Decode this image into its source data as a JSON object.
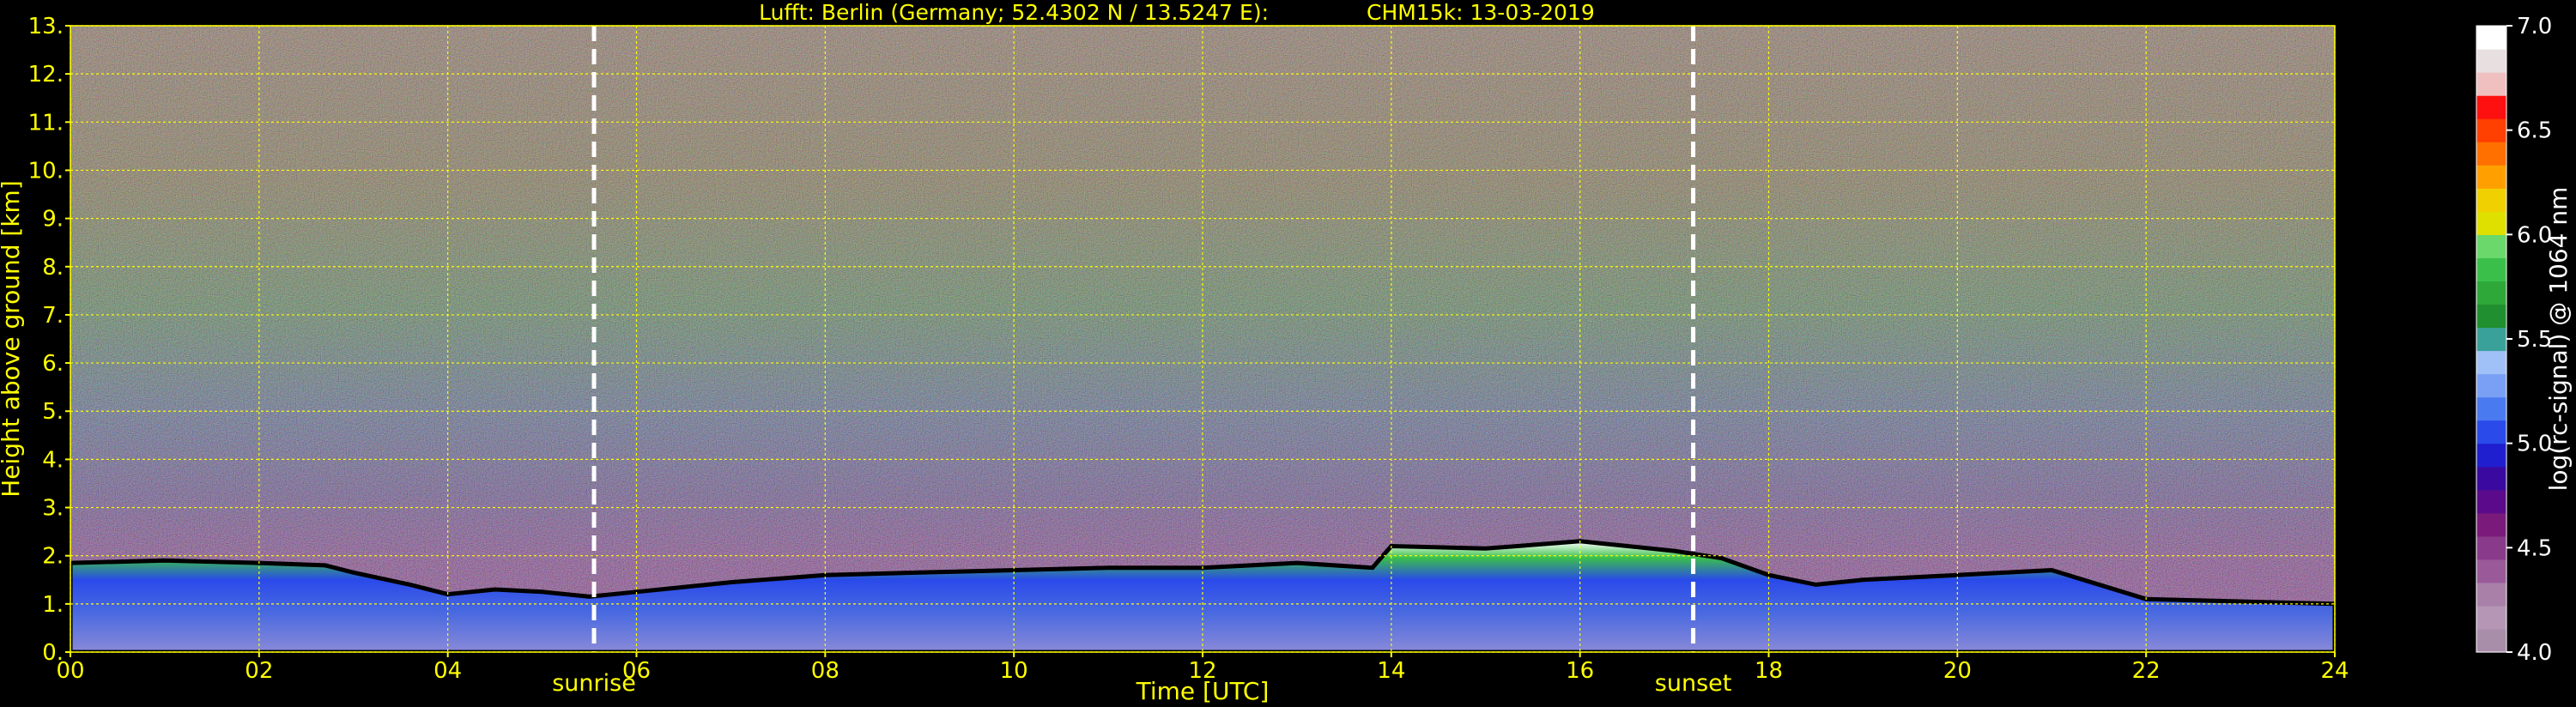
{
  "figure": {
    "title_left": "Lufft: Berlin (Germany; 52.4302 N / 13.5247 E):",
    "title_right": "CHM15k: 13-03-2019",
    "xlabel": "Time [UTC]",
    "ylabel": "Height above ground [km]",
    "colorbar_label": "log(rc-signal) @ 1064 nm"
  },
  "chart_data": {
    "type": "heatmap",
    "title": "Lufft: Berlin (Germany; 52.4302 N / 13.5247 E):    CHM15k: 13-03-2019",
    "xlabel": "Time [UTC]",
    "ylabel": "Height above ground [km]",
    "xlim": [
      0,
      24
    ],
    "ylim": [
      0,
      13
    ],
    "x_ticks": [
      0,
      2,
      4,
      6,
      8,
      10,
      12,
      14,
      16,
      18,
      20,
      22,
      24
    ],
    "x_tick_labels": [
      "00",
      "02",
      "04",
      "06",
      "08",
      "10",
      "12",
      "14",
      "16",
      "18",
      "20",
      "22",
      "24"
    ],
    "y_ticks": [
      0,
      1,
      2,
      3,
      4,
      5,
      6,
      7,
      8,
      9,
      10,
      11,
      12,
      13
    ],
    "y_tick_labels": [
      "0.",
      "1.",
      "2.",
      "3.",
      "4.",
      "5.",
      "6.",
      "7.",
      "8.",
      "9.",
      "10.",
      "11.",
      "12.",
      "13."
    ],
    "grid": true,
    "annotations": [
      {
        "label": "sunrise",
        "x": 5.55
      },
      {
        "label": "sunset",
        "x": 17.2
      }
    ],
    "colorbar": {
      "label": "log(rc-signal) @ 1064 nm",
      "range": [
        4.0,
        7.0
      ],
      "ticks": [
        4.0,
        4.5,
        5.0,
        5.5,
        6.0,
        6.5,
        7.0
      ],
      "tick_labels": [
        "4.0",
        "4.5",
        "5.0",
        "5.5",
        "6.0",
        "6.5",
        "7.0"
      ],
      "colors": [
        "#a88ea8",
        "#b596b5",
        "#a880a8",
        "#9a5a9a",
        "#8a3a8a",
        "#7a1a7a",
        "#5a0a8a",
        "#3a0aa0",
        "#1f1fcf",
        "#2a4aea",
        "#4a7af0",
        "#7aa0f5",
        "#a0c0f8",
        "#3aa09a",
        "#1f8f2f",
        "#2fa83a",
        "#3ac04a",
        "#6ad86a",
        "#e0e000",
        "#f0d000",
        "#ffa000",
        "#ff7000",
        "#ff4000",
        "#ff1010",
        "#f0c0c0",
        "#e8e0e0",
        "#ffffff"
      ]
    },
    "boundary_layer_top_km": [
      [
        0,
        1.85
      ],
      [
        1,
        1.9
      ],
      [
        2,
        1.85
      ],
      [
        2.7,
        1.8
      ],
      [
        3,
        1.65
      ],
      [
        3.6,
        1.4
      ],
      [
        4,
        1.2
      ],
      [
        4.5,
        1.3
      ],
      [
        5,
        1.25
      ],
      [
        5.5,
        1.15
      ],
      [
        6,
        1.25
      ],
      [
        7,
        1.45
      ],
      [
        8,
        1.6
      ],
      [
        9,
        1.65
      ],
      [
        10,
        1.7
      ],
      [
        11,
        1.75
      ],
      [
        12,
        1.75
      ],
      [
        13,
        1.85
      ],
      [
        13.8,
        1.75
      ],
      [
        14,
        2.2
      ],
      [
        15,
        2.15
      ],
      [
        16,
        2.3
      ],
      [
        17,
        2.1
      ],
      [
        17.5,
        1.95
      ],
      [
        18,
        1.6
      ],
      [
        18.5,
        1.4
      ],
      [
        19,
        1.5
      ],
      [
        20,
        1.6
      ],
      [
        21,
        1.7
      ],
      [
        22,
        1.1
      ],
      [
        23,
        1.05
      ],
      [
        24,
        1.0
      ]
    ]
  }
}
